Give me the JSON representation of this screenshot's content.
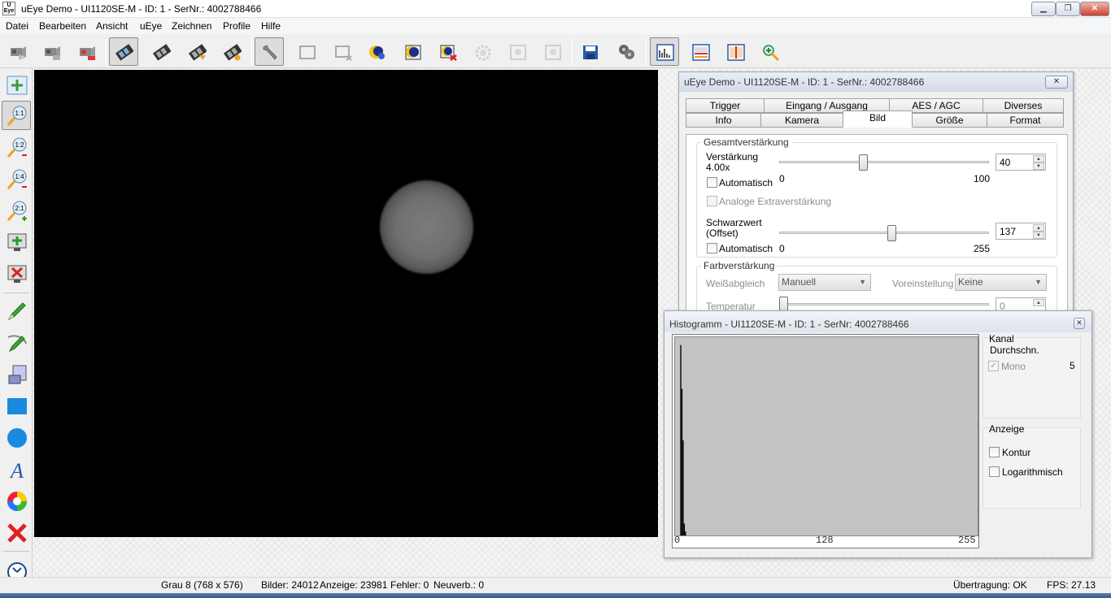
{
  "window": {
    "title": "uEye Demo - UI1120SE-M - ID: 1 - SerNr.: 4002788466"
  },
  "menu": {
    "items": [
      "Datei",
      "Bearbeiten",
      "Ansicht",
      "uEye",
      "Zeichnen",
      "Profile",
      "Hilfe"
    ]
  },
  "toolbar": {
    "icons": [
      "camera-open-icon",
      "camera-close-icon",
      "camera-settings-icon",
      "live-video-icon",
      "snapshot-video-icon",
      "record-video-icon",
      "stop-video-icon",
      "properties-wrench-icon",
      "aoi-icon",
      "aoi-remove-icon",
      "exposure-auto-icon",
      "exposure-icon",
      "exposure-remove-icon",
      "gear-disabled-icon",
      "frame-disabled-icon",
      "frame2-disabled-icon",
      "save-icon",
      "film-reel-icon",
      "histogram-icon",
      "line-view-icon",
      "horizon-view-icon",
      "zoom-in-icon"
    ]
  },
  "left_toolbar": {
    "fit_title": "",
    "zoom_labels": [
      "1:1",
      "1:2",
      "1:4",
      "2:1"
    ]
  },
  "props": {
    "title": "uEye Demo - UI1120SE-M - ID: 1 - SerNr.: 4002788466",
    "tabs_row1": [
      "Trigger",
      "Eingang / Ausgang",
      "AES / AGC",
      "Diverses"
    ],
    "tabs_row2": [
      "Info",
      "Kamera",
      "Bild",
      "Größe",
      "Format"
    ],
    "gain": {
      "group": "Gesamtverstärkung",
      "label": "Verstärkung",
      "factor": "4.00x",
      "min": "0",
      "max": "100",
      "value": "40",
      "auto": "Automatisch",
      "analog": "Analoge Extraverstärkung"
    },
    "black": {
      "label1": "Schwarzwert",
      "label2": "(Offset)",
      "min": "0",
      "max": "255",
      "value": "137",
      "auto": "Automatisch"
    },
    "color": {
      "group": "Farbverstärkung",
      "wb_label": "Weißabgleich",
      "wb_value": "Manuell",
      "preset_label": "Voreinstellung",
      "preset_value": "Keine",
      "temp_label": "Temperatur",
      "temp_value": "0"
    }
  },
  "histo": {
    "title": "Histogramm - UI1120SE-M - ID: 1 - SerNr: 4002788466",
    "ticks": [
      "0",
      "128",
      "255"
    ],
    "kanal": "Kanal",
    "col": "Durchschn.",
    "mono": "Mono",
    "mono_value": "5",
    "anzeige": "Anzeige",
    "kontur": "Kontur",
    "log": "Logarithmisch",
    "bins": [
      {
        "x": 3,
        "h": 96
      },
      {
        "x": 4,
        "h": 74
      },
      {
        "x": 5,
        "h": 48
      },
      {
        "x": 6,
        "h": 6
      },
      {
        "x": 7,
        "h": 2
      }
    ]
  },
  "status": {
    "format": "Grau 8 (768 x 576)",
    "bilder": "Bilder: 24012",
    "anzeige": "Anzeige: 23981",
    "fehler": "Fehler: 0",
    "neuverb": "Neuverb.: 0",
    "uebertragung": "Übertragung: OK",
    "fps": "FPS: 27.13"
  }
}
